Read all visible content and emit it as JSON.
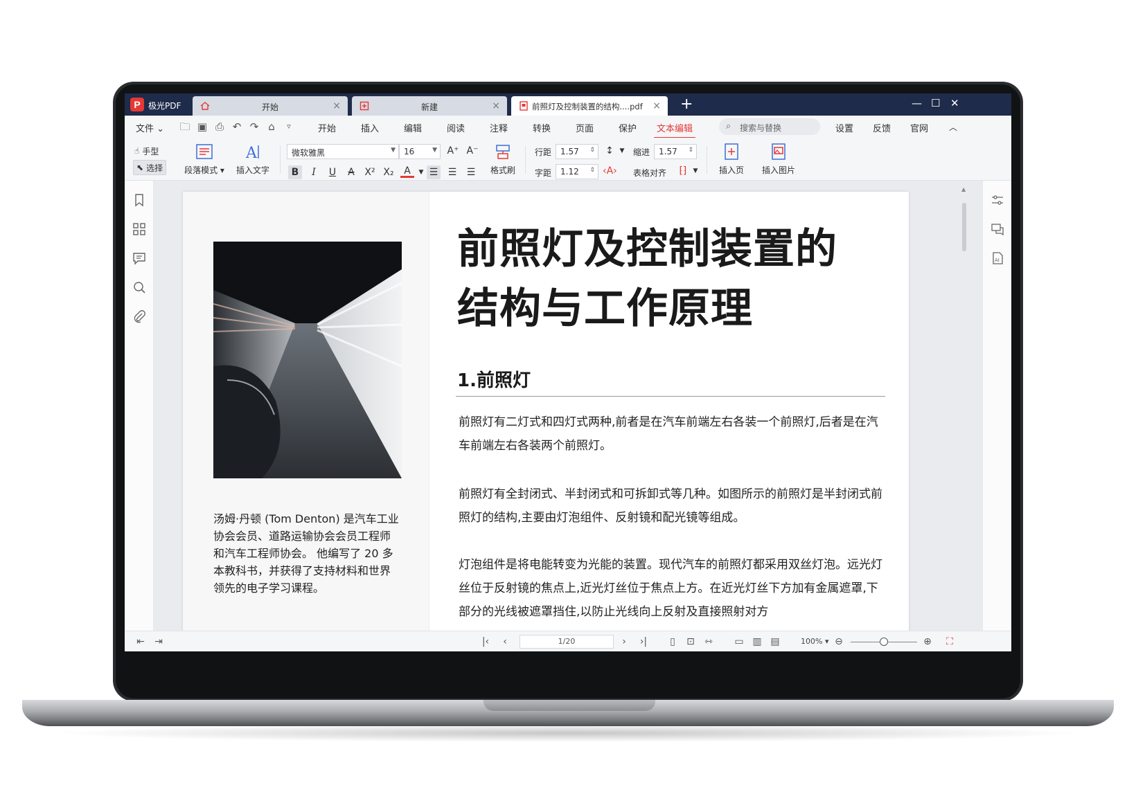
{
  "app": {
    "name": "极光PDF",
    "logo_letter": "P"
  },
  "tabs": [
    {
      "label": "开始",
      "icon": "home-icon"
    },
    {
      "label": "新建",
      "icon": "new-doc-icon"
    },
    {
      "label": "前照灯及控制装置的结构....pdf",
      "icon": "pdf-file-icon",
      "active": true
    }
  ],
  "menu": {
    "file": "文件",
    "items": [
      "开始",
      "插入",
      "编辑",
      "阅读",
      "注释",
      "转换",
      "页面",
      "保护",
      "文本编辑"
    ],
    "active": "文本编辑",
    "search_placeholder": "搜索与替换",
    "right": [
      "设置",
      "反馈",
      "官网"
    ]
  },
  "toolbar": {
    "hand": "手型",
    "select": "选择",
    "paragraph_mode": "段落模式",
    "insert_text": "插入文字",
    "font_name": "微软雅黑",
    "font_size": "16",
    "format_brush": "格式刷",
    "line_spacing_label": "行距",
    "line_spacing": "1.57",
    "indent_label": "缩进",
    "indent": "1.57",
    "char_spacing_label": "字距",
    "char_spacing": "1.12",
    "table_align": "表格对齐",
    "insert_page": "插入页",
    "insert_image": "插入图片"
  },
  "document": {
    "title_line1": "前照灯及控制装置的",
    "title_line2": "结构与工作原理",
    "section": "1.前照灯",
    "caption": "汤姆·丹顿 (Tom Denton) 是汽车工业协会会员、道路运输协会会员工程师和汽车工程师协会。 他编写了 20 多本教科书，并获得了支持材料和世界领先的电子学习课程。",
    "para1": "前照灯有二灯式和四灯式两种,前者是在汽车前端左右各装一个前照灯,后者是在汽车前端左右各装两个前照灯。",
    "para2": "前照灯有全封闭式、半封闭式和可拆卸式等几种。如图所示的前照灯是半封闭式前照灯的结构,主要由灯泡组件、反射镜和配光镜等组成。",
    "para3": "灯泡组件是将电能转变为光能的装置。现代汽车的前照灯都采用双丝灯泡。远光灯丝位于反射镜的焦点上,近光灯丝位于焦点上方。在近光灯丝下方加有金属遮罩,下部分的光线被遮罩挡住,以防止光线向上反射及直接照射对方"
  },
  "statusbar": {
    "page_indicator": "1/20",
    "zoom": "100%",
    "zoom_level": 0.5
  },
  "colors": {
    "accent": "#e53935",
    "titlebar": "#1f2b4a"
  }
}
